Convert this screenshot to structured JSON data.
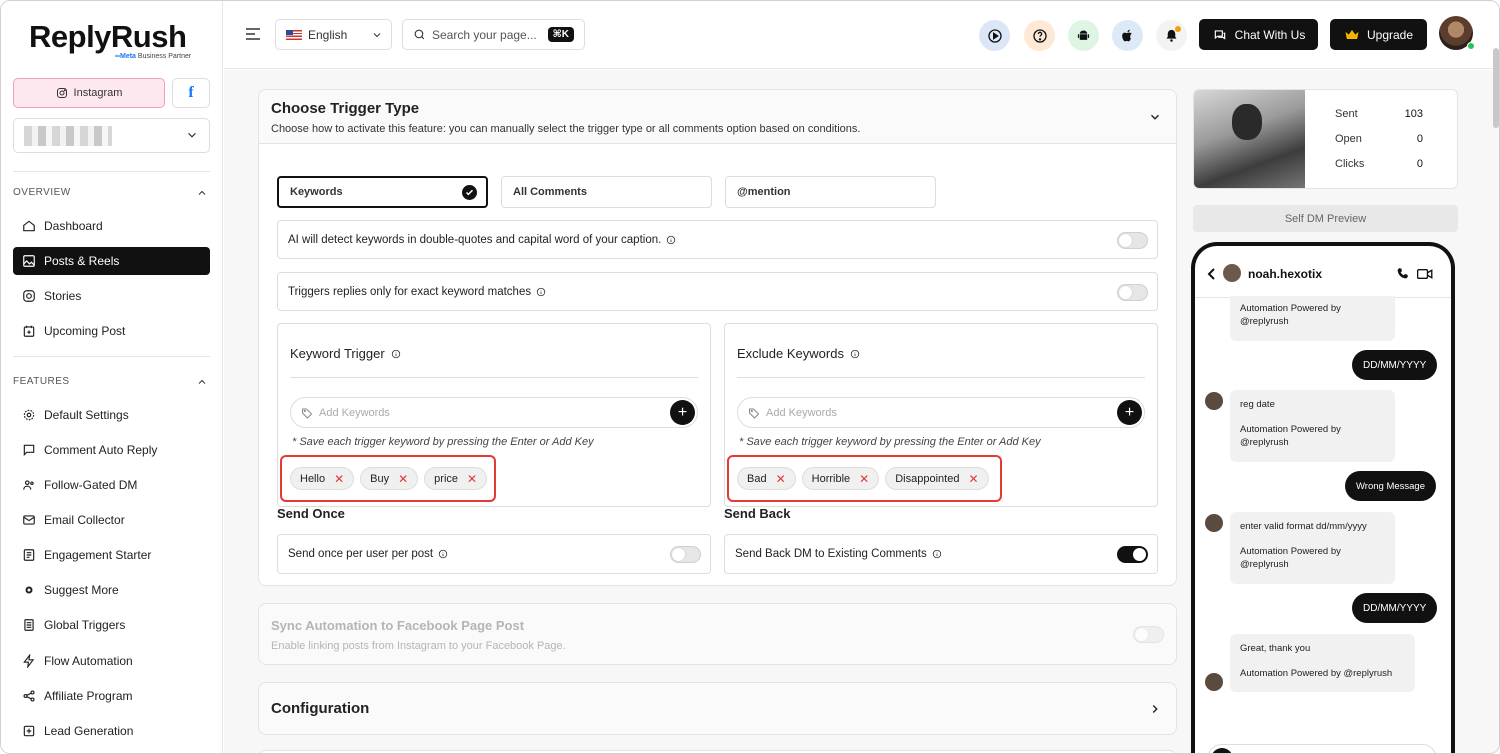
{
  "brand": {
    "name": "ReplyRush",
    "partner_prefix": "∞",
    "partner": "Meta",
    "partner_suffix": " Business Partner"
  },
  "platforms": {
    "instagram": "Instagram",
    "facebook": "f"
  },
  "sidebar": {
    "overview_label": "OVERVIEW",
    "overview_items": [
      {
        "label": "Dashboard",
        "icon": "home-icon"
      },
      {
        "label": "Posts & Reels",
        "icon": "image-icon",
        "active": true
      },
      {
        "label": "Stories",
        "icon": "instagram-icon"
      },
      {
        "label": "Upcoming Post",
        "icon": "calendar-icon"
      }
    ],
    "features_label": "FEATURES",
    "feature_items": [
      {
        "label": "Default Settings",
        "icon": "gear-icon"
      },
      {
        "label": "Comment Auto Reply",
        "icon": "comment-icon"
      },
      {
        "label": "Follow-Gated DM",
        "icon": "users-icon"
      },
      {
        "label": "Email Collector",
        "icon": "mail-icon"
      },
      {
        "label": "Engagement Starter",
        "icon": "list-icon"
      },
      {
        "label": "Suggest More",
        "icon": "sparkle-gear-icon"
      },
      {
        "label": "Global Triggers",
        "icon": "document-icon"
      },
      {
        "label": "Flow Automation",
        "icon": "bolt-icon"
      },
      {
        "label": "Affiliate Program",
        "icon": "share-icon"
      },
      {
        "label": "Lead Generation",
        "icon": "plus-square-icon"
      }
    ]
  },
  "topbar": {
    "language": "English",
    "search_placeholder": "Search your page...",
    "search_shortcut": "⌘K",
    "chat_label": "Chat With Us",
    "upgrade_label": "Upgrade"
  },
  "trigger": {
    "title": "Choose Trigger Type",
    "description": "Choose how to activate this feature: you can manually select the trigger type or all comments option based on conditions.",
    "options": [
      "Keywords",
      "All Comments",
      "@mention"
    ],
    "selected": "Keywords",
    "ai_detect": "AI will detect keywords in double-quotes and capital word of your caption.",
    "exact_match": "Triggers replies only for exact keyword matches",
    "keyword_trigger": {
      "title": "Keyword Trigger",
      "placeholder": "Add Keywords",
      "hint": "* Save each trigger keyword by pressing the Enter or Add Key",
      "chips": [
        "Hello",
        "Buy",
        "price"
      ]
    },
    "exclude_keywords": {
      "title": "Exclude Keywords",
      "placeholder": "Add Keywords",
      "hint": "* Save each trigger keyword by pressing the Enter or Add Key",
      "chips": [
        "Bad",
        "Horrible",
        "Disappointed"
      ]
    },
    "send_once": {
      "heading": "Send Once",
      "label": "Send once per user per post",
      "enabled": false
    },
    "send_back": {
      "heading": "Send Back",
      "label": "Send Back DM to Existing Comments",
      "enabled": true
    }
  },
  "sync": {
    "title": "Sync Automation to Facebook Page Post",
    "description": "Enable linking posts from Instagram to your Facebook Page."
  },
  "configuration": {
    "title": "Configuration"
  },
  "stats": [
    {
      "label": "Sent",
      "value": "103"
    },
    {
      "label": "Open",
      "value": "0"
    },
    {
      "label": "Clicks",
      "value": "0"
    }
  ],
  "dm_preview": {
    "button": "Self DM Preview",
    "username": "noah.hexotix",
    "messages": {
      "m1_line1": "Automation Powered by",
      "m1_line2": "@replyrush",
      "m2": "DD/MM/YYYY",
      "m3_line1": "reg date",
      "m3_line2": "Automation Powered by",
      "m3_line3": "@replyrush",
      "m4": "Wrong Message",
      "m5_line1": "enter valid format dd/mm/yyyy",
      "m5_line2": "Automation Powered by",
      "m5_line3": "@replyrush",
      "m6": "DD/MM/YYYY",
      "m7_line1": "Great, thank you",
      "m7_line2": "Automation Powered by @replyrush"
    }
  },
  "colors": {
    "accent_dark": "#111111",
    "highlight_red": "#e53935",
    "instagram_pink": "#fde8ef",
    "facebook_blue": "#1877f2"
  }
}
